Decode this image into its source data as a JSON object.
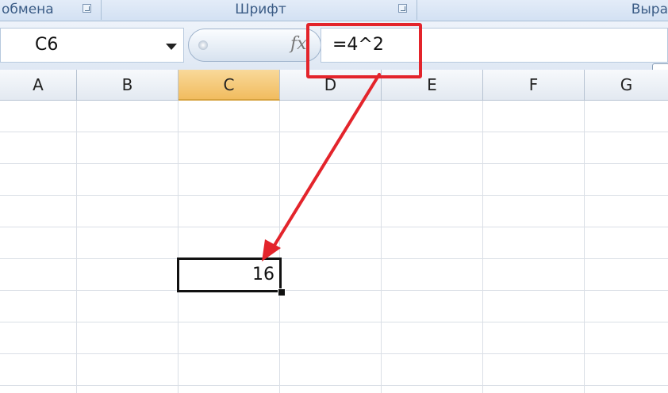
{
  "ribbon": {
    "groups": [
      {
        "label": "обмена"
      },
      {
        "label": "Шрифт"
      },
      {
        "label": "Выра"
      }
    ]
  },
  "formula_bar": {
    "name_box": "C6",
    "fx": "fx",
    "formula": "=4^2"
  },
  "columns": [
    "A",
    "B",
    "C",
    "D",
    "E",
    "F",
    "G"
  ],
  "selected_column": "C",
  "active_cell": {
    "address": "C6",
    "value": "16"
  },
  "colors": {
    "highlight": "#e3242b",
    "selected_header": "#f1bc5f",
    "ribbon_text": "#3b5c86"
  }
}
